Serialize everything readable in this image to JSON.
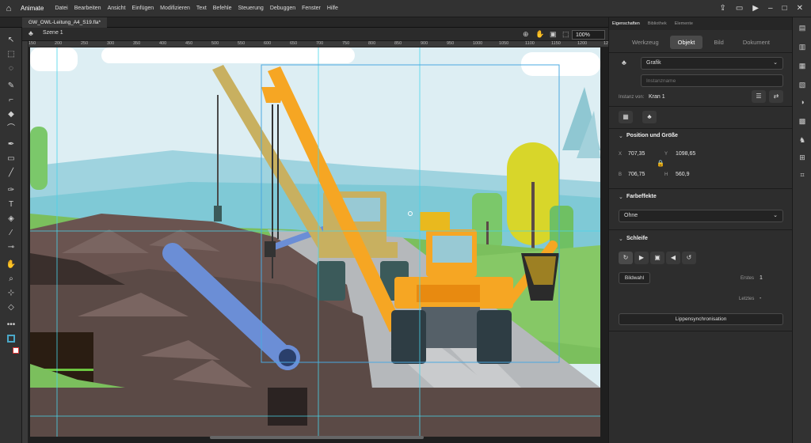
{
  "app": {
    "name": "Animate"
  },
  "menu": [
    "Datei",
    "Bearbeiten",
    "Ansicht",
    "Einfügen",
    "Modifizieren",
    "Text",
    "Befehle",
    "Steuerung",
    "Debuggen",
    "Fenster",
    "Hilfe"
  ],
  "document": {
    "tab": "GW_OWL-Leitung_A4_S19.fla*",
    "scene": "Szene 1",
    "zoom": "100%"
  },
  "ruler_ticks": [
    "150",
    "200",
    "250",
    "300",
    "350",
    "400",
    "450",
    "500",
    "550",
    "600",
    "650",
    "700",
    "750",
    "800",
    "850",
    "900",
    "950",
    "1000",
    "1050",
    "1100",
    "1150",
    "1200",
    "1250",
    "1300",
    "1350",
    "1400"
  ],
  "panel": {
    "tabs": [
      "Eigenschaften",
      "Bibliothek",
      "Elemente"
    ],
    "segments": [
      "Werkzeug",
      "Objekt",
      "Bild",
      "Dokument"
    ],
    "symbol_type": "Grafik",
    "instance_name_placeholder": "Instanzname",
    "instance_of_label": "Instanz von:",
    "instance_of": "Kran 1",
    "position": {
      "title": "Position und Größe",
      "x_label": "X",
      "x": "707,35",
      "y_label": "Y",
      "y": "1098,65",
      "w_label": "B",
      "w": "706,75",
      "h_label": "H",
      "h": "560,9"
    },
    "color": {
      "title": "Farbeffekte",
      "value": "Ohne"
    },
    "loop": {
      "title": "Schleife",
      "pick_button": "Bildwahl",
      "first_label": "Erstes",
      "first": "1",
      "last_label": "Letztes",
      "last": "-",
      "lipsync_button": "Lippensynchronisation"
    }
  },
  "colors": {
    "crane_orange": "#f6a623",
    "crane_yellow": "#c8b060",
    "pipe_blue": "#6b8ed6",
    "sky": "#ddeef3",
    "ground": "#5b4a46"
  }
}
